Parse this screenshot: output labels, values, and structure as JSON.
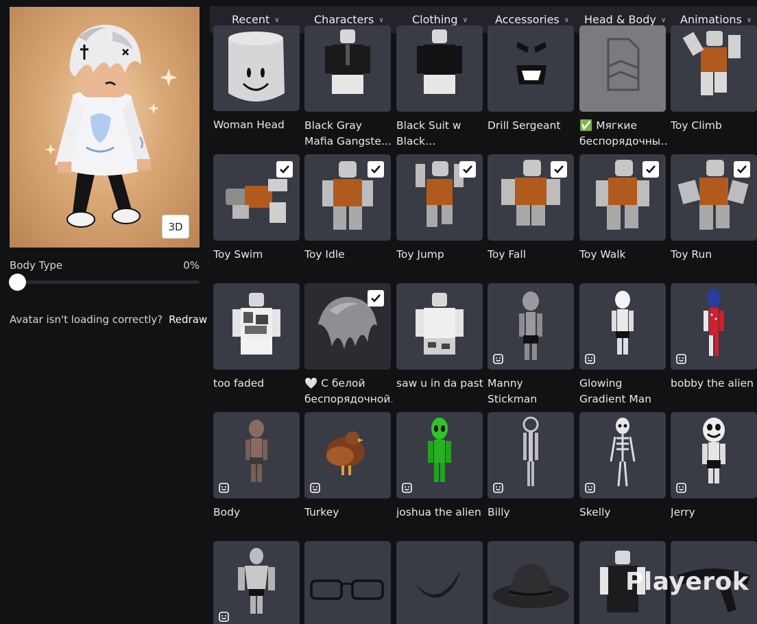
{
  "avatar": {
    "view_button_label": "3D"
  },
  "body_type": {
    "label": "Body Type",
    "value": "0%"
  },
  "redraw": {
    "message": "Avatar isn't loading correctly?",
    "link_label": "Redraw"
  },
  "nav": {
    "items": [
      {
        "label": "Recent"
      },
      {
        "label": "Characters"
      },
      {
        "label": "Clothing"
      },
      {
        "label": "Accessories"
      },
      {
        "label": "Head & Body"
      },
      {
        "label": "Animations"
      }
    ]
  },
  "items": [
    {
      "name": "Woman Head",
      "checked": false,
      "emote": false
    },
    {
      "name": "Black Gray Mafia Gangster Suit…",
      "checked": false,
      "emote": false
    },
    {
      "name": "Black Suit w Black Turtlenec…",
      "checked": false,
      "emote": false
    },
    {
      "name": "Drill Sergeant",
      "checked": false,
      "emote": false
    },
    {
      "name": "✅ Мягкие беспорядочны…",
      "checked": false,
      "emote": false
    },
    {
      "name": "Toy Climb",
      "checked": false,
      "emote": false
    },
    {
      "name": "Toy Swim",
      "checked": true,
      "emote": false
    },
    {
      "name": "Toy Idle",
      "checked": true,
      "emote": false
    },
    {
      "name": "Toy Jump",
      "checked": true,
      "emote": false
    },
    {
      "name": "Toy Fall",
      "checked": true,
      "emote": false
    },
    {
      "name": "Toy Walk",
      "checked": true,
      "emote": false
    },
    {
      "name": "Toy Run",
      "checked": true,
      "emote": false
    },
    {
      "name": "too faded",
      "checked": false,
      "emote": false
    },
    {
      "name": "🤍 С белой беспорядочной…",
      "checked": true,
      "emote": false
    },
    {
      "name": "saw u in da past",
      "checked": false,
      "emote": false
    },
    {
      "name": "Manny Stickman",
      "checked": false,
      "emote": true
    },
    {
      "name": "Glowing Gradient Man",
      "checked": false,
      "emote": true
    },
    {
      "name": "bobby the alien",
      "checked": false,
      "emote": true
    },
    {
      "name": "Body",
      "checked": false,
      "emote": true
    },
    {
      "name": "Turkey",
      "checked": false,
      "emote": true
    },
    {
      "name": "joshua the alien",
      "checked": false,
      "emote": true
    },
    {
      "name": "Billy",
      "checked": false,
      "emote": true
    },
    {
      "name": "Skelly",
      "checked": false,
      "emote": true
    },
    {
      "name": "Jerry",
      "checked": false,
      "emote": true
    },
    {
      "name": "",
      "checked": false,
      "emote": true
    },
    {
      "name": "",
      "checked": false,
      "emote": false
    },
    {
      "name": "",
      "checked": false,
      "emote": false
    },
    {
      "name": "",
      "checked": false,
      "emote": false
    },
    {
      "name": "",
      "checked": false,
      "emote": false
    },
    {
      "name": "",
      "checked": false,
      "emote": false
    }
  ],
  "watermark": "Playerok",
  "colors": {
    "background": "#111214",
    "nav": "#232429",
    "tile": "#393b45",
    "accent": "#ffffff"
  }
}
